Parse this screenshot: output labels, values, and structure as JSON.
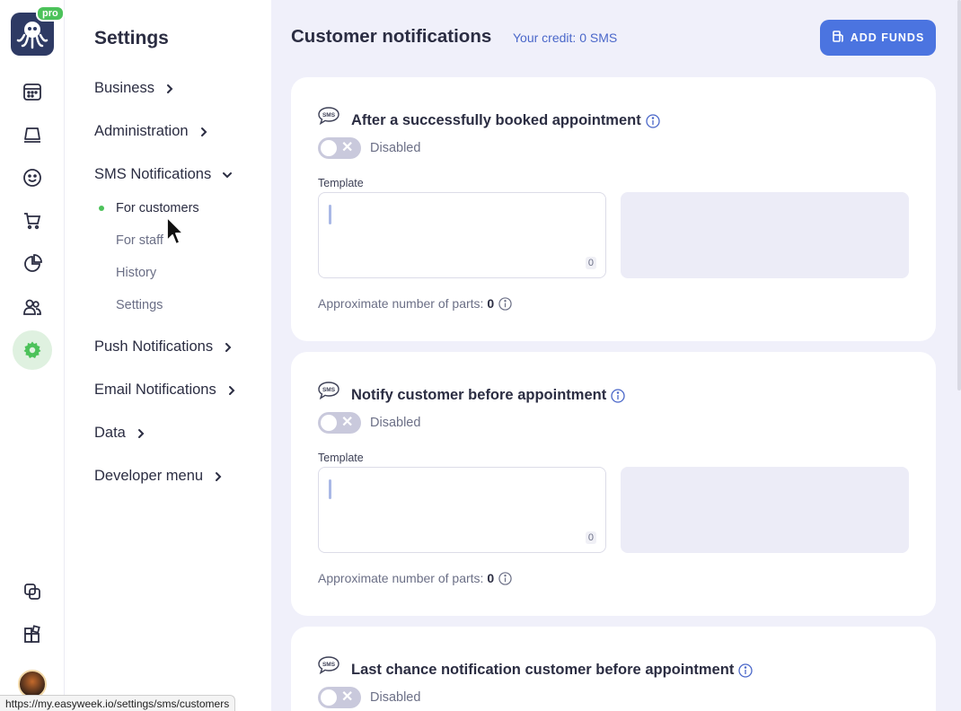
{
  "app": {
    "pro_badge": "pro",
    "status_url": "https://my.easyweek.io/settings/sms/customers",
    "colors": {
      "accent": "#4b74e0",
      "active_green": "#4cc25a",
      "bg": "#f0f0fa"
    }
  },
  "rail": {
    "icons": [
      "calendar-icon",
      "desk-icon",
      "smiley-icon",
      "cart-icon",
      "pie-chart-icon",
      "users-icon",
      "gear-icon",
      "copy-icon",
      "widgets-icon"
    ]
  },
  "side": {
    "title": "Settings",
    "items": [
      {
        "label": "Business"
      },
      {
        "label": "Administration"
      },
      {
        "label": "SMS Notifications"
      },
      {
        "label": "Push Notifications"
      },
      {
        "label": "Email Notifications"
      },
      {
        "label": "Data"
      },
      {
        "label": "Developer menu"
      }
    ],
    "sms_sub": [
      {
        "label": "For customers"
      },
      {
        "label": "For staff"
      },
      {
        "label": "History"
      },
      {
        "label": "Settings"
      }
    ]
  },
  "main": {
    "title": "Customer notifications",
    "credit": "Your credit: 0 SMS",
    "add_funds": "ADD FUNDS",
    "sms_icon_text": "SMS",
    "cards": [
      {
        "title": "After a successfully booked appointment",
        "toggle_label": "Disabled",
        "template_label": "Template",
        "count": "0",
        "parts_label": "Approximate number of parts:",
        "parts_value": "0"
      },
      {
        "title": "Notify customer before appointment",
        "toggle_label": "Disabled",
        "template_label": "Template",
        "count": "0",
        "parts_label": "Approximate number of parts:",
        "parts_value": "0"
      },
      {
        "title": "Last chance notification customer before appointment",
        "toggle_label": "Disabled"
      }
    ]
  }
}
